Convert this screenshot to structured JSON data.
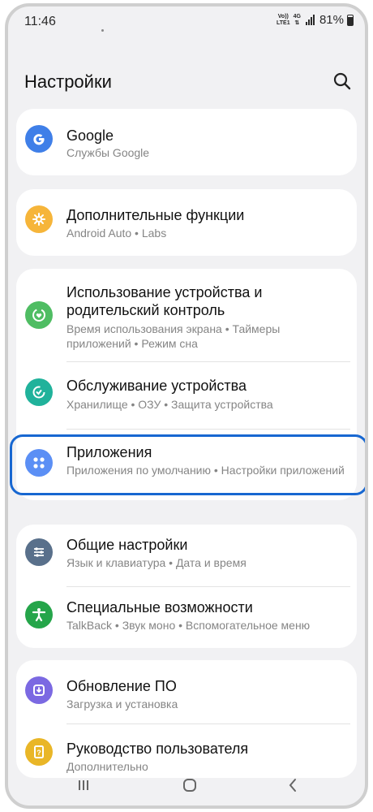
{
  "status_bar": {
    "time": "11:46",
    "network_top": "Vo))",
    "network_mid": "LTE1",
    "network_type": "4G",
    "battery": "81%"
  },
  "header": {
    "title": "Настройки"
  },
  "cards": [
    {
      "items": [
        {
          "title": "Google",
          "subtitle": "Службы Google",
          "icon": "google-icon",
          "color": "#3f7fe8"
        }
      ]
    },
    {
      "items": [
        {
          "title": "Дополнительные функции",
          "subtitle": "Android Auto  •  Labs",
          "icon": "puzzle-icon",
          "color": "#f6b53a"
        }
      ]
    },
    {
      "items": [
        {
          "title": "Использование устройства и родительский контроль",
          "subtitle": "Время использования экрана  •  Таймеры приложений  •  Режим сна",
          "icon": "heart-circle-icon",
          "color": "#4fbd63"
        },
        {
          "title": "Обслуживание устройства",
          "subtitle": "Хранилище  •  ОЗУ  •  Защита устройства",
          "icon": "refresh-circle-icon",
          "color": "#20b29b"
        },
        {
          "title": "Приложения",
          "subtitle": "Приложения по умолчанию  •  Настройки приложений",
          "icon": "apps-grid-icon",
          "color": "#5b8ff5"
        }
      ]
    },
    {
      "items": [
        {
          "title": "Общие настройки",
          "subtitle": "Язык и клавиатура  •  Дата и время",
          "icon": "sliders-icon",
          "color": "#59708b"
        },
        {
          "title": "Специальные возможности",
          "subtitle": "TalkBack  •  Звук моно  •  Вспомогательное меню",
          "icon": "accessibility-icon",
          "color": "#25a54a"
        }
      ]
    },
    {
      "items": [
        {
          "title": "Обновление ПО",
          "subtitle": "Загрузка и установка",
          "icon": "update-icon",
          "color": "#7b69e2"
        },
        {
          "title": "Руководство пользователя",
          "subtitle": "Дополнительно",
          "icon": "manual-icon",
          "color": "#e9b627"
        }
      ]
    }
  ],
  "nav": {
    "recent": "recent-apps-icon",
    "home": "home-icon",
    "back": "back-icon"
  }
}
